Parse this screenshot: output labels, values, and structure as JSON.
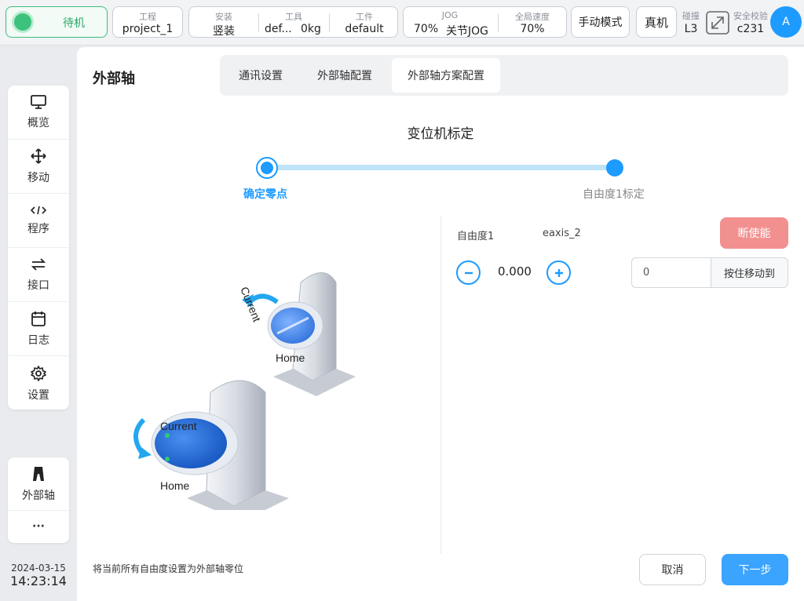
{
  "topbar": {
    "status": "待机",
    "project_label": "工程",
    "project_value": "project_1",
    "install_label": "安装",
    "install_value": "竖装",
    "tool_label": "工具",
    "tool_value": "def...",
    "tool_weight": "0kg",
    "workpiece_label": "工件",
    "workpiece_value": "default",
    "jog_label": "JOG",
    "jog_value": "70%",
    "jog_mode": "关节JOG",
    "speed_label": "全局速度",
    "speed_value": "70%",
    "manual_mode": "手动模式",
    "real_machine": "真机",
    "collision_label": "碰撞",
    "collision_value": "L3",
    "safety_label": "安全校验",
    "safety_value": "c231",
    "avatar": "A"
  },
  "sidebar": {
    "items": [
      {
        "label": "概览",
        "icon": "monitor-icon"
      },
      {
        "label": "移动",
        "icon": "move-icon"
      },
      {
        "label": "程序",
        "icon": "code-icon"
      },
      {
        "label": "接口",
        "icon": "swap-icon"
      },
      {
        "label": "日志",
        "icon": "calendar-icon"
      },
      {
        "label": "设置",
        "icon": "gear-icon"
      }
    ],
    "extra": [
      {
        "label": "外部轴",
        "icon": "external-axis-icon"
      },
      {
        "label": "···",
        "icon": "more-icon"
      }
    ],
    "date": "2024-03-15",
    "time": "14:23:14"
  },
  "main": {
    "title": "外部轴",
    "tabs": [
      {
        "label": "通讯设置"
      },
      {
        "label": "外部轴配置"
      },
      {
        "label": "外部轴方案配置"
      }
    ],
    "heading": "变位机标定",
    "steps": [
      {
        "label": "确定零点"
      },
      {
        "label": "自由度1标定"
      }
    ],
    "illustration": {
      "current": "Current",
      "home": "Home"
    },
    "dof_label": "自由度1",
    "axis_name": "eaxis_2",
    "disable_button": "断使能",
    "value": "0.000",
    "move_input_value": "0",
    "move_button": "按住移动到",
    "footnote": "将当前所有自由度设置为外部轴零位",
    "cancel_button": "取消",
    "next_button": "下一步"
  },
  "colors": {
    "accent": "#1e9bff",
    "status_green": "#3cc27c",
    "danger_light": "#f29090"
  }
}
